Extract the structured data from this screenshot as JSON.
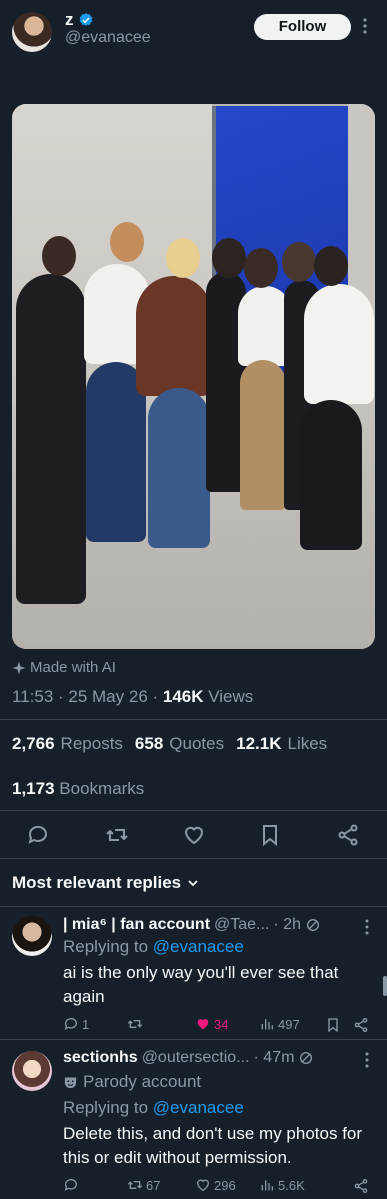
{
  "tweet": {
    "author_name": "z",
    "author_handle": "@evanacee",
    "follow_label": "Follow",
    "made_with_ai": "Made with AI",
    "time": "11:53 · 25 May 26 · ",
    "views_count": "146K",
    "views_label": "Views",
    "reposts_count": "2,766",
    "reposts_label": "Reposts",
    "quotes_count": "658",
    "quotes_label": "Quotes",
    "likes_count": "12.1K",
    "likes_label": "Likes",
    "bookmarks_count": "1,173",
    "bookmarks_label": "Bookmarks"
  },
  "replies_sort": "Most relevant replies",
  "replies": [
    {
      "name": "| mia⁶ | fan account",
      "handle": "@Tae...",
      "time": "· 2h",
      "replying_prefix": "Replying to",
      "replying_to": "@evanacee",
      "text": "ai is the only way you'll ever see that again",
      "stats": {
        "reply": "1",
        "repost": "",
        "like": "34",
        "views": "497"
      }
    },
    {
      "name": "sectionhs",
      "handle": "@outersectio...",
      "time": "· 47m",
      "badge": "Parody account",
      "replying_prefix": "Replying to",
      "replying_to": "@evanacee",
      "text": "Delete this, and don't use my photos for this or edit without permission.",
      "stats": {
        "reply": "",
        "repost": "67",
        "like": "296",
        "views": "5.6K"
      }
    }
  ],
  "colors": {
    "background": "#15202b",
    "muted": "#8b98a5",
    "link": "#1d9bf0",
    "like_active": "#f91880",
    "verified": "#1d9bf0"
  },
  "icons": [
    "verified-icon",
    "more-icon",
    "sparkle-icon",
    "reply-icon",
    "repost-icon",
    "like-icon",
    "bookmark-icon",
    "share-icon",
    "chevron-down-icon",
    "ai-no-icon",
    "views-icon",
    "parody-icon"
  ]
}
